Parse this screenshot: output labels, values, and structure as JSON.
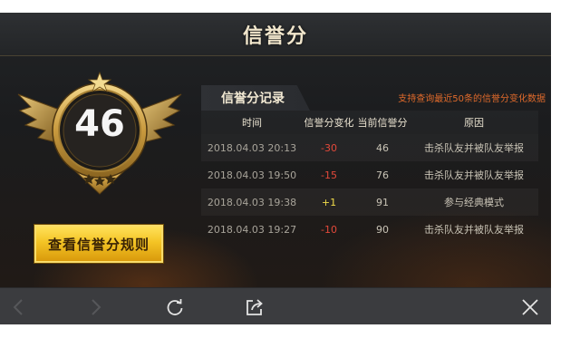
{
  "header": {
    "title": "信誉分"
  },
  "badge": {
    "score": "46"
  },
  "rules_button": {
    "label": "查看信誉分规则"
  },
  "records": {
    "tab_label": "信誉分记录",
    "note": "支持查询最近50条的信誉分变化数据",
    "columns": [
      "时间",
      "信誉分变化",
      "当前信誉分",
      "原因"
    ],
    "rows": [
      {
        "time": "2018.04.03 20:13",
        "change": "-30",
        "current": "46",
        "reason": "击杀队友并被队友举报"
      },
      {
        "time": "2018.04.03 19:50",
        "change": "-15",
        "current": "76",
        "reason": "击杀队友并被队友举报"
      },
      {
        "time": "2018.04.03 19:38",
        "change": "+1",
        "current": "91",
        "reason": "参与经典模式"
      },
      {
        "time": "2018.04.03 19:27",
        "change": "-10",
        "current": "90",
        "reason": "击杀队友并被队友举报"
      }
    ]
  },
  "toolbar": {
    "icons": [
      "back-icon",
      "forward-icon",
      "refresh-icon",
      "share-icon",
      "close-icon"
    ]
  },
  "colors": {
    "accent_gold": "#f4c425",
    "negative": "#e3493a",
    "positive": "#f1dc4a",
    "note_orange": "#e06a2b"
  }
}
